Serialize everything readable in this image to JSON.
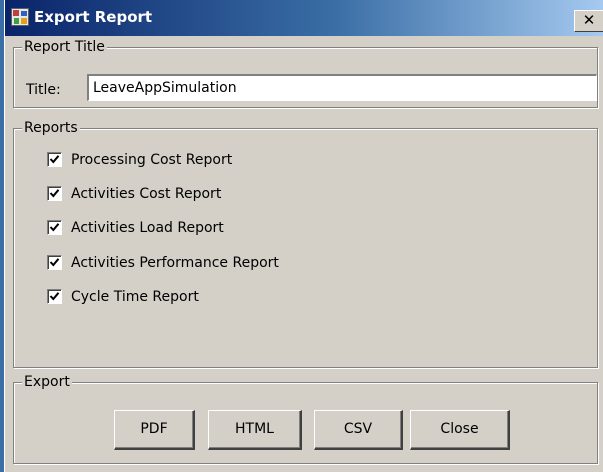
{
  "window": {
    "title": "Export Report",
    "close_glyph": "✕",
    "icon": "export-report-icon"
  },
  "report_title": {
    "legend": "Report Title",
    "label": "Title:",
    "value": "LeaveAppSimulation"
  },
  "reports": {
    "legend": "Reports",
    "items": [
      {
        "label": "Processing Cost Report",
        "checked": true
      },
      {
        "label": "Activities Cost Report",
        "checked": true
      },
      {
        "label": "Activities Load Report",
        "checked": true
      },
      {
        "label": "Activities Performance Report",
        "checked": true
      },
      {
        "label": "Cycle Time Report",
        "checked": true
      }
    ]
  },
  "export": {
    "legend": "Export",
    "buttons": [
      "PDF",
      "HTML",
      "CSV",
      "Close"
    ]
  },
  "colors": {
    "titlebar_start": "#0a246a",
    "titlebar_end": "#a6caf0",
    "dialog_face": "#d4d0c8"
  }
}
